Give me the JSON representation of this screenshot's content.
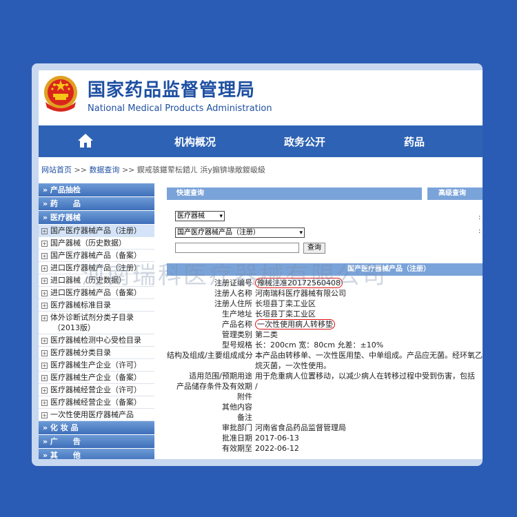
{
  "header": {
    "title_cn": "国家药品监督管理局",
    "title_en": "National Medical Products Administration"
  },
  "nav": {
    "items": [
      "机构概况",
      "政务公开",
      "药品"
    ]
  },
  "breadcrumb": {
    "home": "网站首页",
    "sep1": ">>",
    "data_query": "数据查询",
    "sep2": ">>",
    "rest": "鍥戒骇鍖荤枟鍣ㄦ  浜у搧锛堟敞鍐岋級"
  },
  "sidebar": {
    "cat_product_check": "» 产品抽检",
    "cat_drugs": "» 药　　品",
    "cat_devices": "» 医疗器械",
    "items": [
      "国产医疗器械产品（注册）",
      "国产器械（历史数据）",
      "国产医疗器械产品（备案）",
      "进口医疗器械产品（注册）",
      "进口器械（历史数据）",
      "进口医疗器械产品（备案）",
      "医疗器械标准目录",
      "医疗器械检测中心受检目录",
      "医疗器械分类目录",
      "医疗器械生产企业（许可）",
      "医疗器械生产企业（备案）",
      "医疗器械经营企业（许可）",
      "医疗器械经营企业（备案）",
      "一次性使用医疗器械产品"
    ],
    "ivd_line1": "体外诊断试剂分类子目录",
    "ivd_line2": "（2013版）",
    "cat_cosmetics": "» 化 妆 品",
    "cat_ads": "» 广　　告",
    "cat_other": "» 其　　他"
  },
  "query": {
    "quick_tab": "快速查询",
    "advanced_tab": "高级查询",
    "select1": "医疗器械",
    "select2": "国产医疗器械产品（注册）",
    "search_value": "",
    "search_button": "查询",
    "results_title": "国产医疗器械产品（注册）"
  },
  "record": {
    "labels": {
      "reg_no": "注册证编号",
      "registrant": "注册人名称",
      "residence": "注册人住所",
      "address": "生产地址",
      "product": "产品名称",
      "category": "管理类别",
      "spec": "型号规格",
      "composition": "结构及组成/主要组成成分",
      "scope": "适用范围/预期用途",
      "storage": "产品储存条件及有效期",
      "attachment": "附件",
      "other": "其他内容",
      "remarks": "备注",
      "approver": "审批部门",
      "approve_date": "批准日期",
      "valid_until": "有效期至"
    },
    "values": {
      "reg_no": "豫械注准20172560408",
      "registrant": "河南瑞科医疗器械有限公司",
      "residence": "长垣县丁栾工业区",
      "address": "长垣县丁栾工业区",
      "product": "一次性使用病人转移垫",
      "category": "第二类",
      "spec": "长：200cm 宽：80cm 允差：±10%",
      "composition": "本产品由转移单、一次性医用垫、中单组成。产品应无菌。经环氧乙烷灭菌，一次性使用。",
      "scope": "用于危重病人位置移动，以减少病人在转移过程中受到伤害，包括",
      "storage": "/",
      "attachment": "",
      "other": "",
      "remarks": "",
      "approver": "河南省食品药品监督管理局",
      "approve_date": "2017-06-13",
      "valid_until": "2022-06-12"
    }
  },
  "watermark": "河南瑞科医疗器械有限公司",
  "colors": {
    "background": "#2b5cb5",
    "nav": "#2e62b4",
    "title": "#1e4fa2",
    "highlight": "#d11111"
  }
}
